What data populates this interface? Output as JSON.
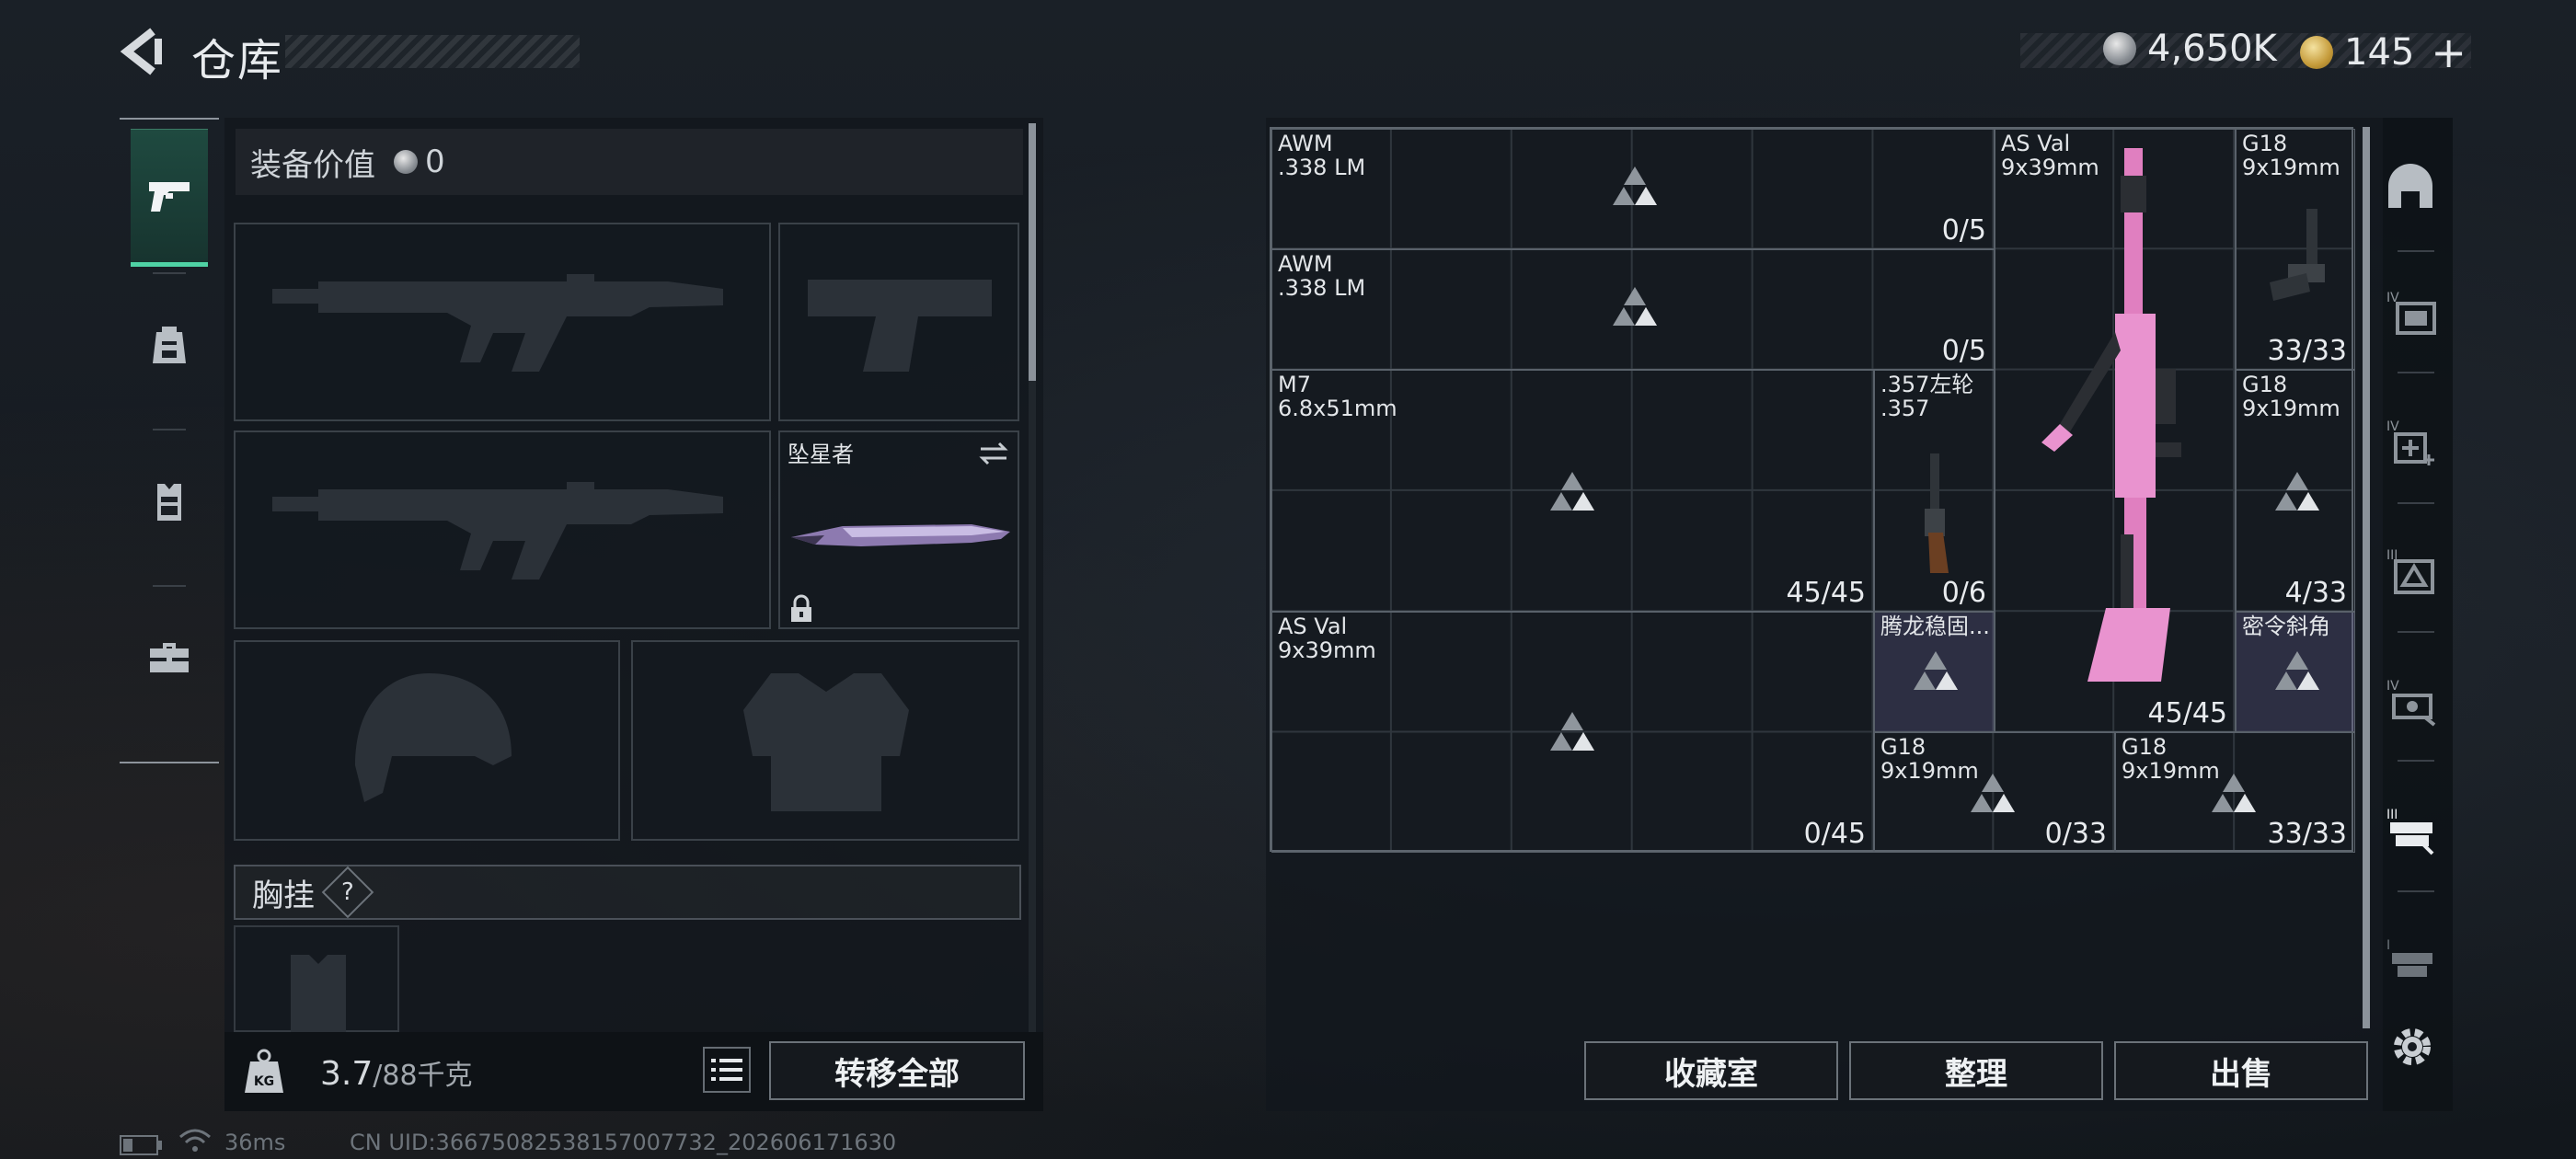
{
  "header": {
    "title": "仓库",
    "silver": "4,650K",
    "gold": "145",
    "plus": "+"
  },
  "equipment": {
    "value_label": "装备价值",
    "value": "0",
    "melee_name": "坠星者",
    "chest_label": "胸挂",
    "help": "?",
    "weight_current": "3.7",
    "weight_max": "/88千克",
    "transfer_all": "转移全部"
  },
  "storage": {
    "items": [
      {
        "name": "AWM\n.338 LM",
        "count": "0/5"
      },
      {
        "name": "AWM\n.338 LM",
        "count": "0/5"
      },
      {
        "name": "M7\n6.8x51mm",
        "count": "45/45"
      },
      {
        "name": "AS Val\n9x39mm",
        "count": "0/45"
      },
      {
        "name": ".357左轮\n.357",
        "count": "0/6"
      },
      {
        "name": "AS Val\n9x39mm",
        "count": "45/45"
      },
      {
        "name": "G18\n9x19mm",
        "count": "33/33"
      },
      {
        "name": "G18\n9x19mm",
        "count": "4/33"
      },
      {
        "name": "密令斜角",
        "count": ""
      },
      {
        "name": "腾龙稳固...",
        "count": ""
      },
      {
        "name": "G18\n9x19mm",
        "count": "0/33"
      },
      {
        "name": "G18\n9x19mm",
        "count": "33/33"
      }
    ],
    "buttons": {
      "collection": "收藏室",
      "sort": "整理",
      "sell": "出售"
    }
  },
  "status": {
    "ping": "36ms",
    "uid": "CN UID:36675082538157007732_202606171630"
  },
  "colors": {
    "accent": "#4fd2a4",
    "highlight": "#5b4f86"
  },
  "icons": [
    "back-arrow-icon",
    "silver-coin-icon",
    "gold-coin-icon",
    "pistol-icon",
    "backpack-icon",
    "chest-rig-icon",
    "toolbox-icon",
    "swap-icon",
    "lock-icon",
    "weight-icon",
    "list-icon",
    "settings-icon",
    "battery-icon",
    "wifi-icon",
    "ammo-triangle-icon"
  ]
}
